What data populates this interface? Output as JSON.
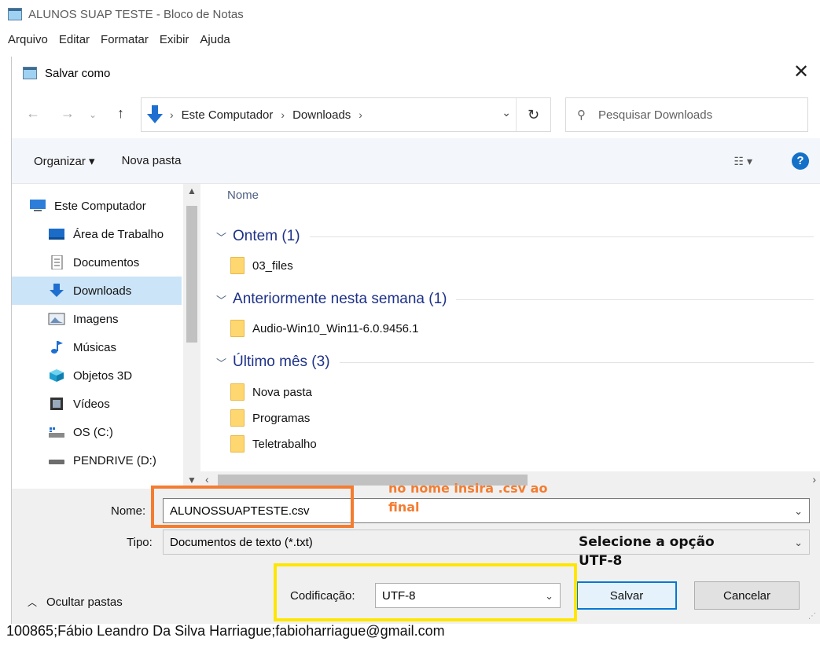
{
  "notepad": {
    "title": "ALUNOS SUAP TESTE - Bloco de Notas",
    "menu": [
      "Arquivo",
      "Editar",
      "Formatar",
      "Exibir",
      "Ajuda"
    ],
    "last_line": "100865;Fábio Leandro Da Silva Harriague;fabioharriague@gmail.com"
  },
  "dialog": {
    "title": "Salvar como",
    "close_glyph": "✕",
    "address": {
      "segments": [
        "Este Computador",
        "Downloads"
      ],
      "separator": "›"
    },
    "search_placeholder": "Pesquisar Downloads",
    "toolbar": {
      "organize": "Organizar ▾",
      "new_folder": "Nova pasta",
      "help": "?"
    },
    "nav_items": [
      {
        "label": "Este Computador",
        "icon": "computer-icon"
      },
      {
        "label": "Área de Trabalho",
        "icon": "desktop-icon"
      },
      {
        "label": "Documentos",
        "icon": "documents-icon"
      },
      {
        "label": "Downloads",
        "icon": "downloads-icon",
        "selected": true
      },
      {
        "label": "Imagens",
        "icon": "pictures-icon"
      },
      {
        "label": "Músicas",
        "icon": "music-icon"
      },
      {
        "label": "Objetos 3D",
        "icon": "objects3d-icon"
      },
      {
        "label": "Vídeos",
        "icon": "videos-icon"
      },
      {
        "label": "OS (C:)",
        "icon": "drive-c-icon"
      },
      {
        "label": "PENDRIVE (D:)",
        "icon": "usb-drive-icon"
      }
    ],
    "column_header": "Nome",
    "groups": [
      {
        "label": "Ontem (1)",
        "files": [
          "03_files"
        ]
      },
      {
        "label": "Anteriormente nesta semana (1)",
        "files": [
          "Audio-Win10_Win11-6.0.9456.1"
        ]
      },
      {
        "label": "Último mês (3)",
        "files": [
          "Nova pasta",
          "Programas",
          "Teletrabalho"
        ]
      }
    ],
    "form": {
      "name_label": "Nome:",
      "name_value": "ALUNOSSUAPTESTE.csv",
      "type_label": "Tipo:",
      "type_value": "Documentos de texto (*.txt)",
      "encoding_label": "Codificação:",
      "encoding_value": "UTF-8",
      "save": "Salvar",
      "cancel": "Cancelar",
      "hide_folders": "Ocultar pastas"
    }
  },
  "annotations": {
    "name_hint_line1": "no nome insira .csv ao",
    "name_hint_line2": "final",
    "encoding_hint_line1": "Selecione a opção",
    "encoding_hint_line2": "UTF-8",
    "name_color": "#f47c30",
    "encoding_color": "#ffe600"
  }
}
